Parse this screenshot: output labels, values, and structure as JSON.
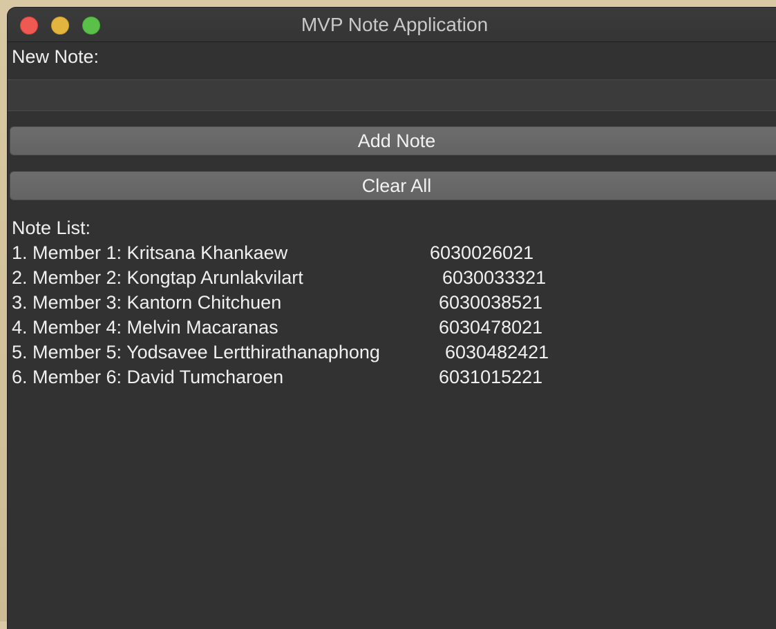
{
  "window": {
    "title": "MVP Note Application"
  },
  "form": {
    "new_note_label": "New Note:",
    "input_value": "",
    "add_button_label": "Add Note",
    "clear_button_label": "Clear All"
  },
  "notes": {
    "list_label": "Note List:",
    "items": [
      {
        "text": "1. Member 1: Kritsana Khankaew",
        "id": "6030026021"
      },
      {
        "text": "2. Member 2: Kongtap Arunlakvilart",
        "id": "6030033321"
      },
      {
        "text": "3. Member 3: Kantorn Chitchuen",
        "id": "6030038521"
      },
      {
        "text": "4. Member 4: Melvin Macaranas",
        "id": "6030478021"
      },
      {
        "text": "5. Member 5: Yodsavee Lertthirathanaphong",
        "id": "6030482421"
      },
      {
        "text": "6. Member 6: David Tumcharoen",
        "id": "6031015221"
      }
    ]
  },
  "colors": {
    "close": "#ee5a52",
    "minimize": "#e3b53f",
    "maximize": "#5ac04a",
    "window_bg": "#323232",
    "button_bg": "#6d6d6d"
  }
}
